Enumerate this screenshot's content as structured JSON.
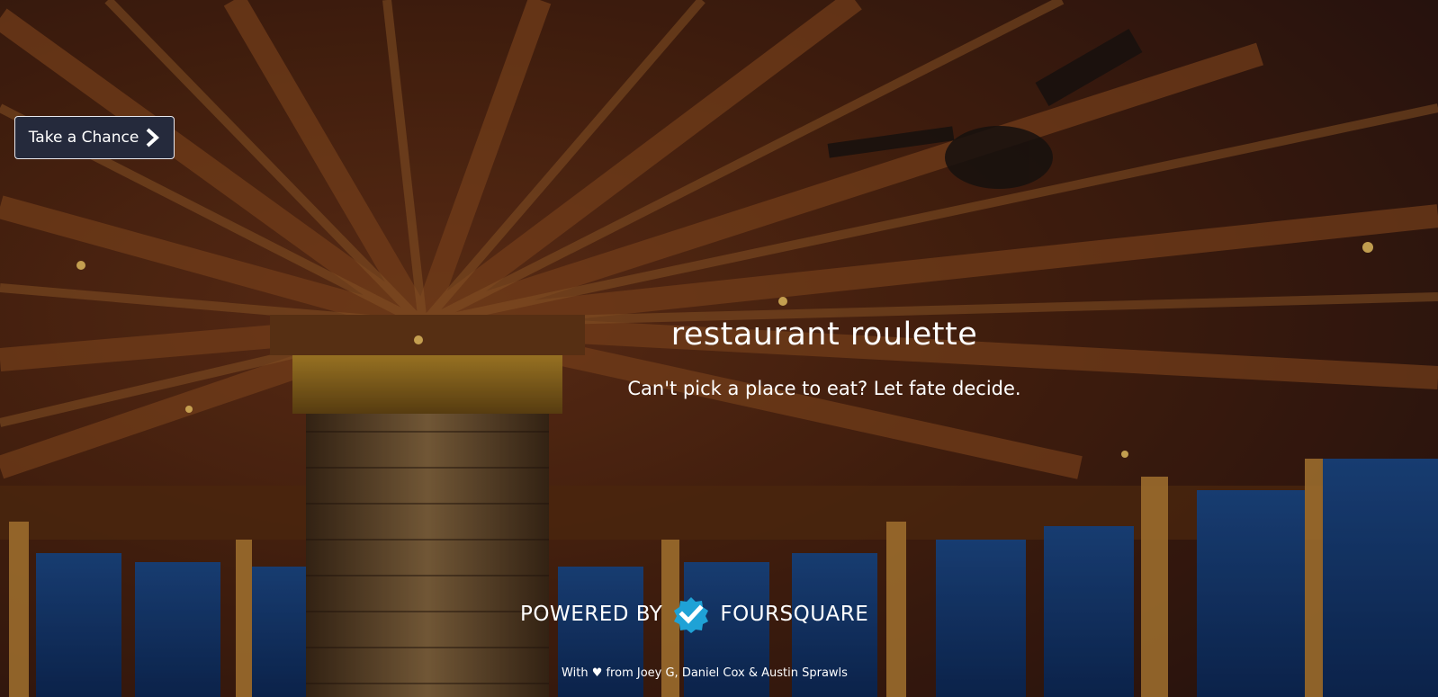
{
  "nav": {
    "take_chance_label": "Take a Chance",
    "take_chance_icon": "chevron-right-icon"
  },
  "hero": {
    "title": "restaurant roulette",
    "subtitle": "Can't pick a place to eat? Let fate decide."
  },
  "footer": {
    "powered_by": "POWERED BY",
    "brand": "FOURSQUARE",
    "brand_icon": "foursquare-logo-icon",
    "credits": "With ♥ from Joey G, Daniel Cox & Austin Sprawls"
  },
  "colors": {
    "button_bg": "#252a3c",
    "text": "#ffffff",
    "foursquare_accent": "#1fa2d6"
  }
}
